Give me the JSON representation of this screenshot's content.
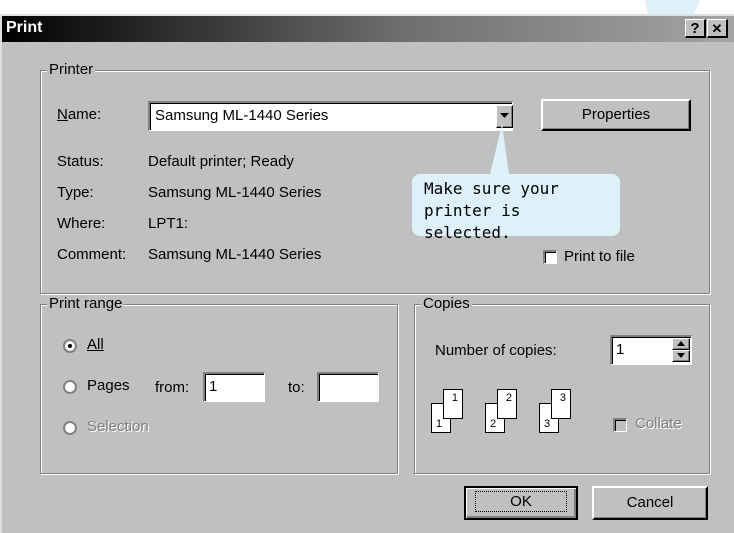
{
  "window": {
    "title": "Print",
    "help_glyph": "?",
    "close_glyph": "✕"
  },
  "printer": {
    "legend": "Printer",
    "name_label": "Name:",
    "selected_printer": "Samsung ML-1440 Series",
    "properties_label": "Properties",
    "status_label": "Status:",
    "status_value": "Default printer; Ready",
    "type_label": "Type:",
    "type_value": "Samsung ML-1440 Series",
    "where_label": "Where:",
    "where_value": "LPT1:",
    "comment_label": "Comment:",
    "comment_value": "Samsung ML-1440 Series",
    "print_to_file_label": "Print to file",
    "print_to_file_checked": false
  },
  "print_range": {
    "legend": "Print range",
    "all_label": "All",
    "pages_label": "Pages",
    "from_label": "from:",
    "from_value": "1",
    "to_label": "to:",
    "to_value": "",
    "selection_label": "Selection",
    "selected": "All"
  },
  "copies": {
    "legend": "Copies",
    "number_label": "Number of copies:",
    "number_value": "1",
    "collate_label": "Collate",
    "collate_checked": false,
    "collate_icons": [
      "1",
      "1",
      "2",
      "2",
      "3",
      "3"
    ]
  },
  "buttons": {
    "ok": "OK",
    "cancel": "Cancel"
  },
  "callout": {
    "line1": "Make sure your",
    "line2": "printer is selected."
  },
  "colors": {
    "dialog_face": "#c0c0c0",
    "callout_bg": "#def1fb"
  }
}
